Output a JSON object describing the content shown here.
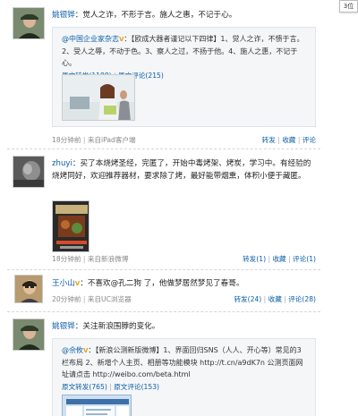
{
  "corner_tag": "3位",
  "posts": [
    {
      "author": "姚银铧",
      "text": "觉人之诈，不形于言。施人之惠，不记于心。",
      "retweet": {
        "author": "@中国企业家杂志",
        "vmark": "V",
        "text": "【欧成大器者谨记以下四律】1、觉人之诈，不愦于言。2、受人之辱，不动于色。3、察人之过，不扬于他。4、施人之惠，不记于心。",
        "repost_label": "原文转发(1188)",
        "comment_label": "原文评论(215)"
      },
      "time": "18分钟前",
      "source": "来自iPad客户端",
      "actions": {
        "forward": "转发",
        "favorite": "收藏",
        "comment": "评论"
      }
    },
    {
      "author": "zhuyi",
      "text": "买了本烧烤圣经，完匿了，开始中毒烤架、烤炭，学习中。有经验的烧烤同好，欢迎推荐器材，要求除了烤，最好能带烟熏，体积小便于藏匿。",
      "time": "18分钟前",
      "source": "来自新浪微博",
      "actions": {
        "forward": "转发(1)",
        "favorite": "收藏",
        "comment": "评论(1)"
      }
    },
    {
      "author": "王小山",
      "vmark": "V",
      "text": "不喜欢@孔二狗 了，他做梦居然梦见了春哥。",
      "time": "20分钟前",
      "source": "来自UC浏览器",
      "actions": {
        "forward": "转发(24)",
        "favorite": "收藏",
        "comment": "评论(28)"
      }
    },
    {
      "author": "姚银铧",
      "text": "关注新浪围脖的变化。",
      "retweet": {
        "author": "@佘攸",
        "vmark": "V",
        "text": "【新浪公测新版微博】1、界面回归SNS（人人、开心等）常见的3栏布局 2、新增个人主页、相册等功能模块 http://t.cn/a9dK7n 公测页面网址请点击 http://weibo.com/beta.html",
        "repost_label": "原文转发(765)",
        "comment_label": "原文评论(153)"
      }
    }
  ]
}
